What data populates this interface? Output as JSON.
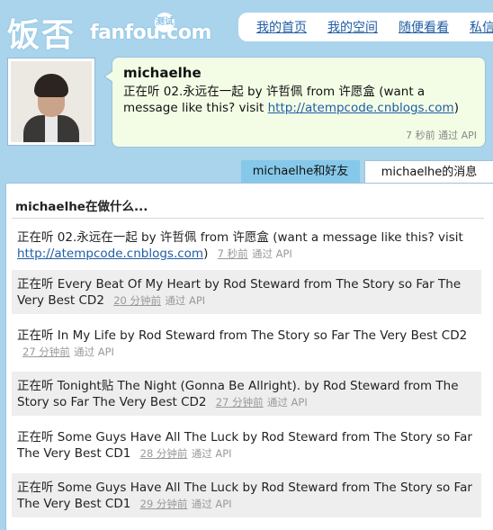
{
  "logo": {
    "cn": "饭否",
    "en": "fanfou.com",
    "badge": "测试"
  },
  "nav": {
    "items": [
      "我的首页",
      "我的空间",
      "随便看看",
      "私信"
    ]
  },
  "profile": {
    "name": "michaelhe",
    "status_prefix": "正在听 02.永远在一起 by 许哲佩 from 许愿盒 (want a message like this? visit ",
    "status_link": "http://atempcode.cnblogs.com",
    "status_suffix": ")",
    "meta": "7 秒前 通过 API"
  },
  "tabs": {
    "friends": "michaelhe和好友",
    "messages": "michaelhe的消息"
  },
  "panel": {
    "title": "michaelhe在做什么...",
    "messages": [
      {
        "text": "正在听 02.永远在一起 by 许哲佩 from 许愿盒 (want a message like this? visit ",
        "link": "http://atempcode.cnblogs.com",
        "suffix": ")",
        "time": "7 秒前",
        "via": "通过 API"
      },
      {
        "text": "正在听 Every Beat Of My Heart by Rod Steward from The Story so Far The Very Best CD2",
        "time": "20 分钟前",
        "via": "通过 API"
      },
      {
        "text": "正在听 In My Life by Rod Steward from The Story so Far The Very Best CD2",
        "time": "27 分钟前",
        "via": "通过 API"
      },
      {
        "text": "正在听 Tonight贴 The Night (Gonna Be Allright). by Rod Steward from The Story so Far The Very Best CD2",
        "time": "27 分钟前",
        "via": "通过 API"
      },
      {
        "text": "正在听 Some Guys Have All The Luck by Rod Steward from The Story so Far The Very Best CD1",
        "time": "28 分钟前",
        "via": "通过 API"
      },
      {
        "text": "正在听 Some Guys Have All The Luck by Rod Steward from The Story so Far The Very Best CD1",
        "time": "29 分钟前",
        "via": "通过 API"
      }
    ]
  }
}
